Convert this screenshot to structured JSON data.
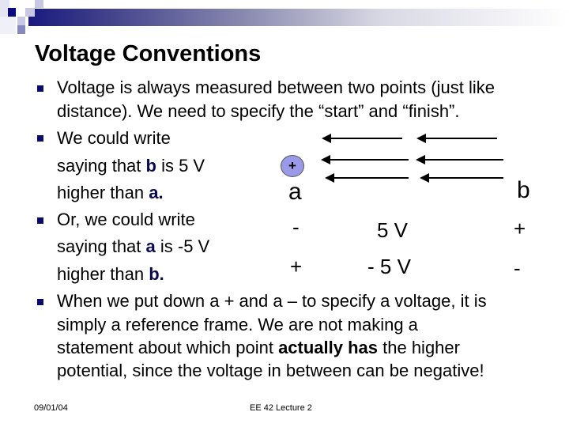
{
  "slide": {
    "title": "Voltage Conventions",
    "bullets": [
      {
        "lines": [
          "Voltage is always measured between two points (just like",
          "distance).  We need to specify the “start” and “finish”."
        ]
      },
      {
        "lines": [
          "We could write"
        ],
        "cont": [
          {
            "pre": "saying that ",
            "bold": "b",
            "post": " is 5 V"
          },
          {
            "pre": "higher than ",
            "bold": "a.",
            "post": ""
          }
        ]
      },
      {
        "lines": [
          "Or, we could write"
        ],
        "cont": [
          {
            "pre": "saying that ",
            "bold": "a",
            "post": " is -5 V"
          },
          {
            "pre": "higher than ",
            "bold": "b.",
            "post": ""
          }
        ]
      },
      {
        "lines": [
          "When we put down a + and a – to specify a voltage, it is",
          "simply a reference frame.  We are not making a"
        ],
        "line3": {
          "pre": "statement about which point ",
          "bold": "actually has",
          "post": " the higher"
        },
        "line4": "potential, since the voltage in between can be negative!"
      }
    ]
  },
  "diagram": {
    "charge_icon": "positive-charge-icon",
    "charge_sign": "+",
    "point_a": "a",
    "point_b": "b",
    "row1": {
      "left": "-",
      "value": "5 V",
      "right": "+"
    },
    "row2": {
      "left": "+",
      "value": "- 5 V",
      "right": "-"
    },
    "arrow_icon": "left-arrow-icon"
  },
  "footer": {
    "date": "09/01/04",
    "course": "EE 42 Lecture 2"
  }
}
